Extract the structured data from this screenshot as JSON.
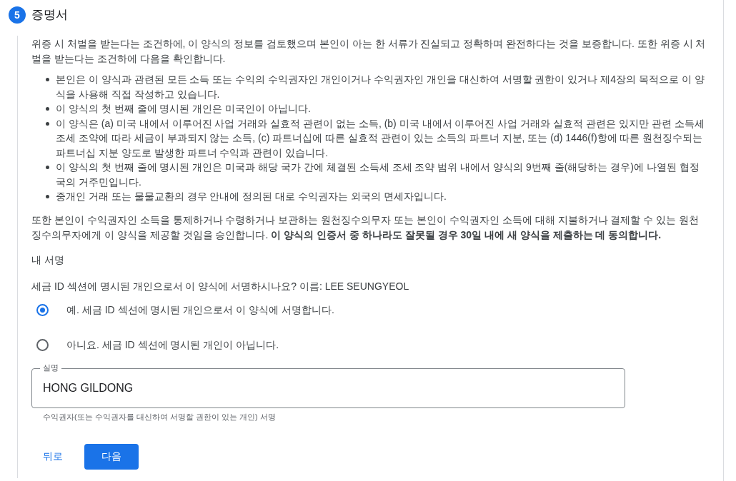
{
  "step": {
    "number": "5",
    "title": "증명서"
  },
  "intro": "위증 시 처벌을 받는다는 조건하에, 이 양식의 정보를 검토했으며 본인이 아는 한 서류가 진실되고 정확하며 완전하다는 것을 보증합니다. 또한 위증 시 처벌을 받는다는 조건하에 다음을 확인합니다.",
  "certifications": [
    "본인은 이 양식과 관련된 모든 소득 또는 수익의 수익권자인 개인이거나 수익권자인 개인을 대신하여 서명할 권한이 있거나 제4장의 목적으로 이 양식을 사용해 직접 작성하고 있습니다.",
    "이 양식의 첫 번째 줄에 명시된 개인은 미국인이 아닙니다.",
    "이 양식은 (a) 미국 내에서 이루어진 사업 거래와 실효적 관련이 없는 소득, (b) 미국 내에서 이루어진 사업 거래와 실효적 관련은 있지만 관련 소득세 조세 조약에 따라 세금이 부과되지 않는 소득, (c) 파트너십에 따른 실효적 관련이 있는 소득의 파트너 지분, 또는 (d) 1446(f)항에 따른 원천징수되는 파트너십 지분 양도로 발생한 파트너 수익과 관련이 있습니다.",
    "이 양식의 첫 번째 줄에 명시된 개인은 미국과 해당 국가 간에 체결된 소득세 조세 조약 범위 내에서 양식의 9번째 줄(해당하는 경우)에 나열된 협정국의 거주민입니다.",
    "중개인 거래 또는 물물교환의 경우 안내에 정의된 대로 수익권자는 외국의 면세자입니다."
  ],
  "consent": "또한 본인이 수익권자인 소득을 통제하거나 수령하거나 보관하는 원천징수의무자 또는 본인이 수익권자인 소득에 대해 지불하거나 결제할 수 있는 원천징수의무자에게 이 양식을 제공할 것임을 승인합니다. **이 양식의 인증서 중 하나라도 잘못될 경우 30일 내에 새 양식을 제출하는 데 동의합니다.**",
  "signature": {
    "heading": "내 서명",
    "question": "세금 ID 섹션에 명시된 개인으로서 이 양식에 서명하시나요? 이름: LEE SEUNGYEOL",
    "options": [
      {
        "label": "예. 세금 ID 섹션에 명시된 개인으로서 이 양식에 서명합니다.",
        "selected": true
      },
      {
        "label": "아니요. 세금 ID 섹션에 명시된 개인이 아닙니다.",
        "selected": false
      }
    ],
    "name_field": {
      "label": "실명",
      "value": "HONG GILDONG",
      "helper": "수익권자(또는 수익권자를 대신하여 서명할 권한이 있는 개인) 서명"
    }
  },
  "buttons": [
    {
      "label": "뒤로",
      "kind": "text"
    },
    {
      "label": "다음",
      "kind": "primary"
    }
  ]
}
